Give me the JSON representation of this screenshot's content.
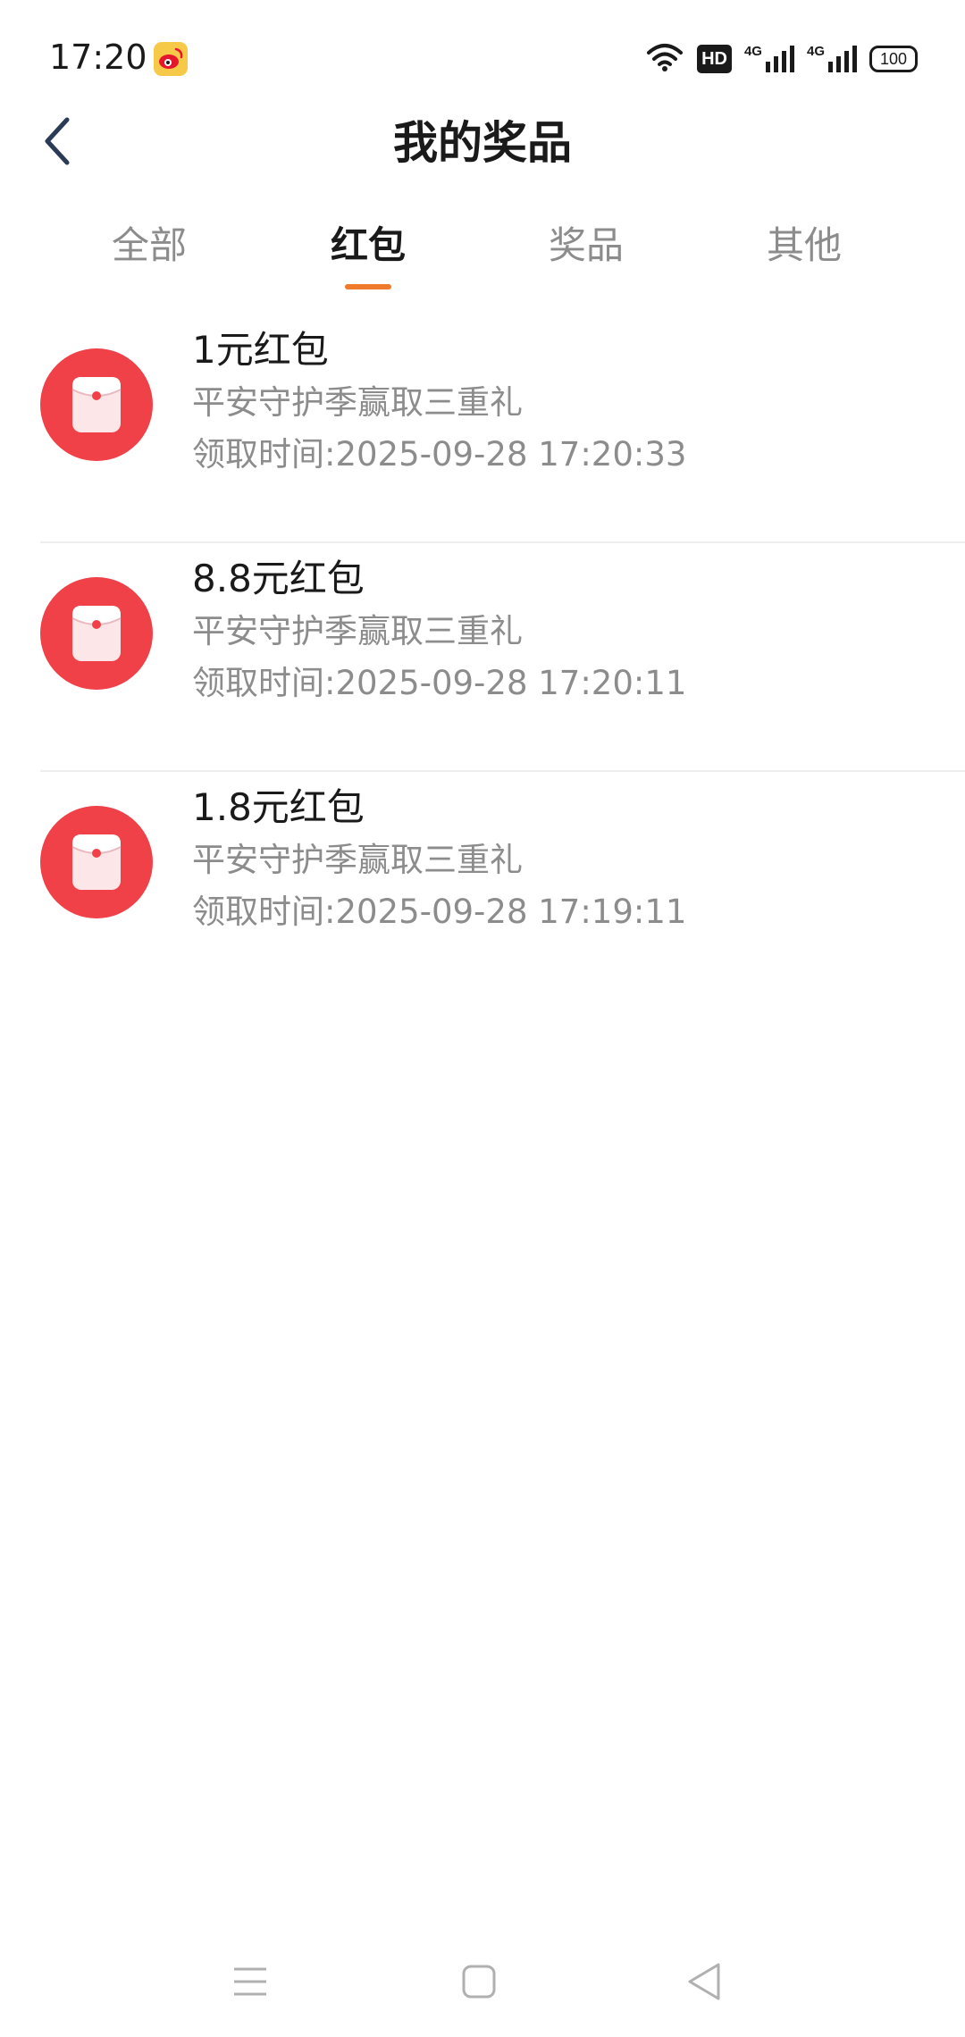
{
  "status_bar": {
    "time": "17:20",
    "app_icon": "weibo-icon",
    "hd_label": "HD",
    "network_1": "4G",
    "network_2": "4G",
    "battery": "100"
  },
  "header": {
    "title": "我的奖品",
    "back_icon": "chevron-left-icon"
  },
  "tabs": [
    {
      "label": "全部",
      "active": false
    },
    {
      "label": "红包",
      "active": true
    },
    {
      "label": "奖品",
      "active": false
    },
    {
      "label": "其他",
      "active": false
    }
  ],
  "colors": {
    "accent": "#f07b2d",
    "envelope": "#f04048"
  },
  "items": [
    {
      "title": "1元红包",
      "subtitle": "平安守护季赢取三重礼",
      "time": "领取时间:2025-09-28 17:20:33"
    },
    {
      "title": "8.8元红包",
      "subtitle": "平安守护季赢取三重礼",
      "time": "领取时间:2025-09-28 17:20:11"
    },
    {
      "title": "1.8元红包",
      "subtitle": "平安守护季赢取三重礼",
      "time": "领取时间:2025-09-28 17:19:11"
    }
  ],
  "nav": {
    "menu_icon": "menu-icon",
    "home_icon": "home-square-icon",
    "back_icon": "back-triangle-icon"
  }
}
